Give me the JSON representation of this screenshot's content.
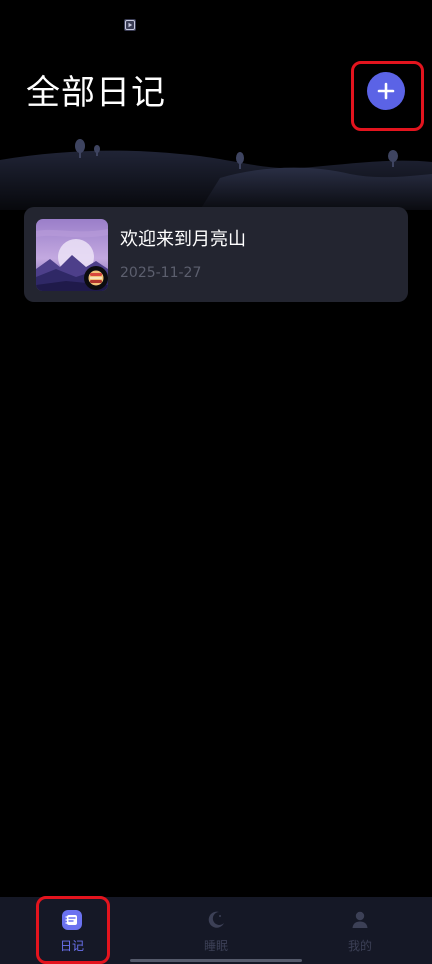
{
  "status_bar": {
    "notification_icon": "media-play-icon"
  },
  "header": {
    "title": "全部日记",
    "add_icon": "plus-icon"
  },
  "diary_entries": [
    {
      "title": "欢迎来到月亮山",
      "date": "2025-11-27",
      "thumbnail_icon": "moon-mountain-image",
      "mood_icon": "mood-badge-icon"
    }
  ],
  "tab_bar": {
    "tabs": [
      {
        "label": "日记",
        "icon": "diary-icon",
        "active": true
      },
      {
        "label": "睡眠",
        "icon": "moon-icon",
        "active": false
      },
      {
        "label": "我的",
        "icon": "person-icon",
        "active": false
      }
    ]
  },
  "colors": {
    "background": "#000000",
    "accent": "#5b63e6",
    "card": "#232530",
    "date_text": "#5c5f6e",
    "tab_bar": "#151826",
    "tab_active": "#6b72f0",
    "tab_inactive": "#3c4056",
    "highlight": "#e3141e"
  }
}
